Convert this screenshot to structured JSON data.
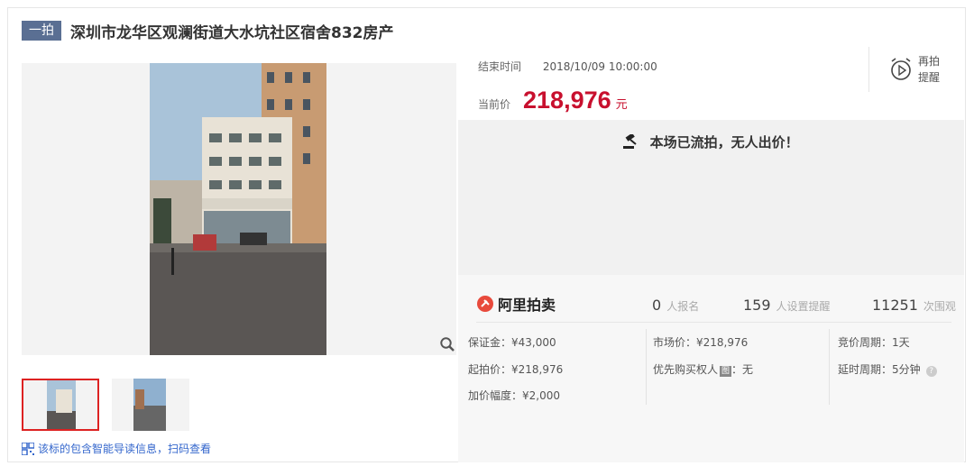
{
  "header": {
    "badge": "一拍",
    "title": "深圳市龙华区观澜街道大水坑社区宿舍832房产"
  },
  "gallery": {
    "qr_text": "该标的包含智能导读信息，扫码查看"
  },
  "auction": {
    "end_label": "结束时间",
    "end_time": "2018/10/09 10:00:00",
    "price_label": "当前价",
    "price": "218,976",
    "price_unit": "元",
    "remind_line1": "再拍",
    "remind_line2": "提醒",
    "status": "本场已流拍，无人出价！"
  },
  "stats": {
    "logo": "阿里拍卖",
    "signup_count": "0",
    "signup_label": "人报名",
    "reminder_count": "159",
    "reminder_label": "人设置提醒",
    "view_count": "11251",
    "view_label": "次围观"
  },
  "details": {
    "deposit": "保证金：¥43,000",
    "start_price": "起拍价：¥218,976",
    "increment": "加价幅度：¥2,000",
    "market_price": "市场价：¥218,976",
    "priority_label": "优先购买权人",
    "priority_tag": "图",
    "priority_value": "：无",
    "bid_period": "竞价周期：1天",
    "delay_period": "延时周期：5分钟"
  },
  "colors": {
    "accent": "#c8102e",
    "badge": "#5a6f93",
    "link": "#3366cc"
  }
}
